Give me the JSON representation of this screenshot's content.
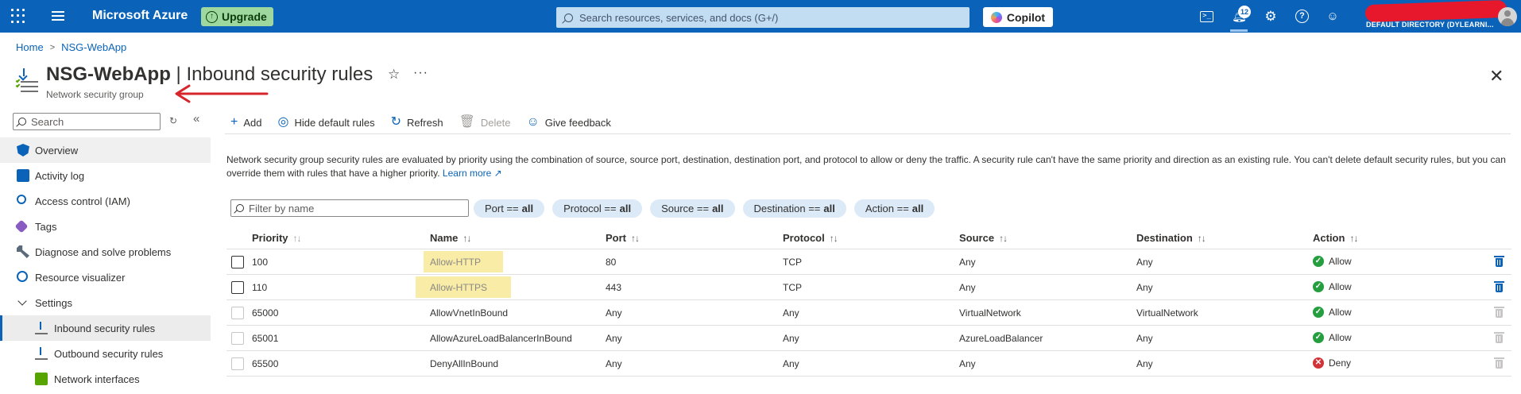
{
  "topbar": {
    "brand": "Microsoft Azure",
    "upgrade_label": "Upgrade",
    "search_placeholder": "Search resources, services, and docs (G+/)",
    "copilot_label": "Copilot",
    "notification_count": "12",
    "directory": "DEFAULT DIRECTORY (DYLEARNI..."
  },
  "breadcrumb": [
    "Home",
    "NSG-WebApp"
  ],
  "header": {
    "resource_name": "NSG-WebApp",
    "separator": " | ",
    "page_title": "Inbound security rules",
    "resource_type": "Network security group"
  },
  "nav": {
    "search_placeholder": "Search",
    "items": [
      {
        "label": "Overview",
        "icon": "shield-icon"
      },
      {
        "label": "Activity log",
        "icon": "activity-log-icon"
      },
      {
        "label": "Access control (IAM)",
        "icon": "iam-icon"
      },
      {
        "label": "Tags",
        "icon": "tag-icon"
      },
      {
        "label": "Diagnose and solve problems",
        "icon": "wrench-icon"
      },
      {
        "label": "Resource visualizer",
        "icon": "visualizer-icon"
      },
      {
        "label": "Settings",
        "icon": "chevron-down-icon"
      },
      {
        "label": "Inbound security rules",
        "icon": "inbound-icon"
      },
      {
        "label": "Outbound security rules",
        "icon": "outbound-icon"
      },
      {
        "label": "Network interfaces",
        "icon": "nic-icon"
      }
    ]
  },
  "toolbar": {
    "add": "Add",
    "hide_default": "Hide default rules",
    "refresh": "Refresh",
    "delete": "Delete",
    "feedback": "Give feedback"
  },
  "description": {
    "text": "Network security group security rules are evaluated by priority using the combination of source, source port, destination, destination port, and protocol to allow or deny the traffic. A security rule can't have the same priority and direction as an existing rule. You can't delete default security rules, but you can override them with rules that have a higher priority.",
    "learn_more": "Learn more"
  },
  "filters": {
    "placeholder": "Filter by name",
    "pills": [
      {
        "label": "Port ==",
        "value": "all"
      },
      {
        "label": "Protocol ==",
        "value": "all"
      },
      {
        "label": "Source ==",
        "value": "all"
      },
      {
        "label": "Destination ==",
        "value": "all"
      },
      {
        "label": "Action ==",
        "value": "all"
      }
    ]
  },
  "table": {
    "columns": [
      "Priority",
      "Name",
      "Port",
      "Protocol",
      "Source",
      "Destination",
      "Action"
    ],
    "rows": [
      {
        "priority": "100",
        "name": "Allow-HTTP",
        "port": "80",
        "protocol": "TCP",
        "source": "Any",
        "destination": "Any",
        "action": "Allow"
      },
      {
        "priority": "110",
        "name": "Allow-HTTPS",
        "port": "443",
        "protocol": "TCP",
        "source": "Any",
        "destination": "Any",
        "action": "Allow"
      },
      {
        "priority": "65000",
        "name": "AllowVnetInBound",
        "port": "Any",
        "protocol": "Any",
        "source": "VirtualNetwork",
        "destination": "VirtualNetwork",
        "action": "Allow"
      },
      {
        "priority": "65001",
        "name": "AllowAzureLoadBalancerInBound",
        "port": "Any",
        "protocol": "Any",
        "source": "AzureLoadBalancer",
        "destination": "Any",
        "action": "Allow"
      },
      {
        "priority": "65500",
        "name": "DenyAllInBound",
        "port": "Any",
        "protocol": "Any",
        "source": "Any",
        "destination": "Any",
        "action": "Deny"
      }
    ]
  },
  "colors": {
    "topbar": "#0a63b8",
    "accent": "#0a63b8",
    "allow": "#249e3f",
    "deny": "#d13438",
    "highlight": "#f6e58a",
    "annotation_arrow": "#d6262c"
  }
}
